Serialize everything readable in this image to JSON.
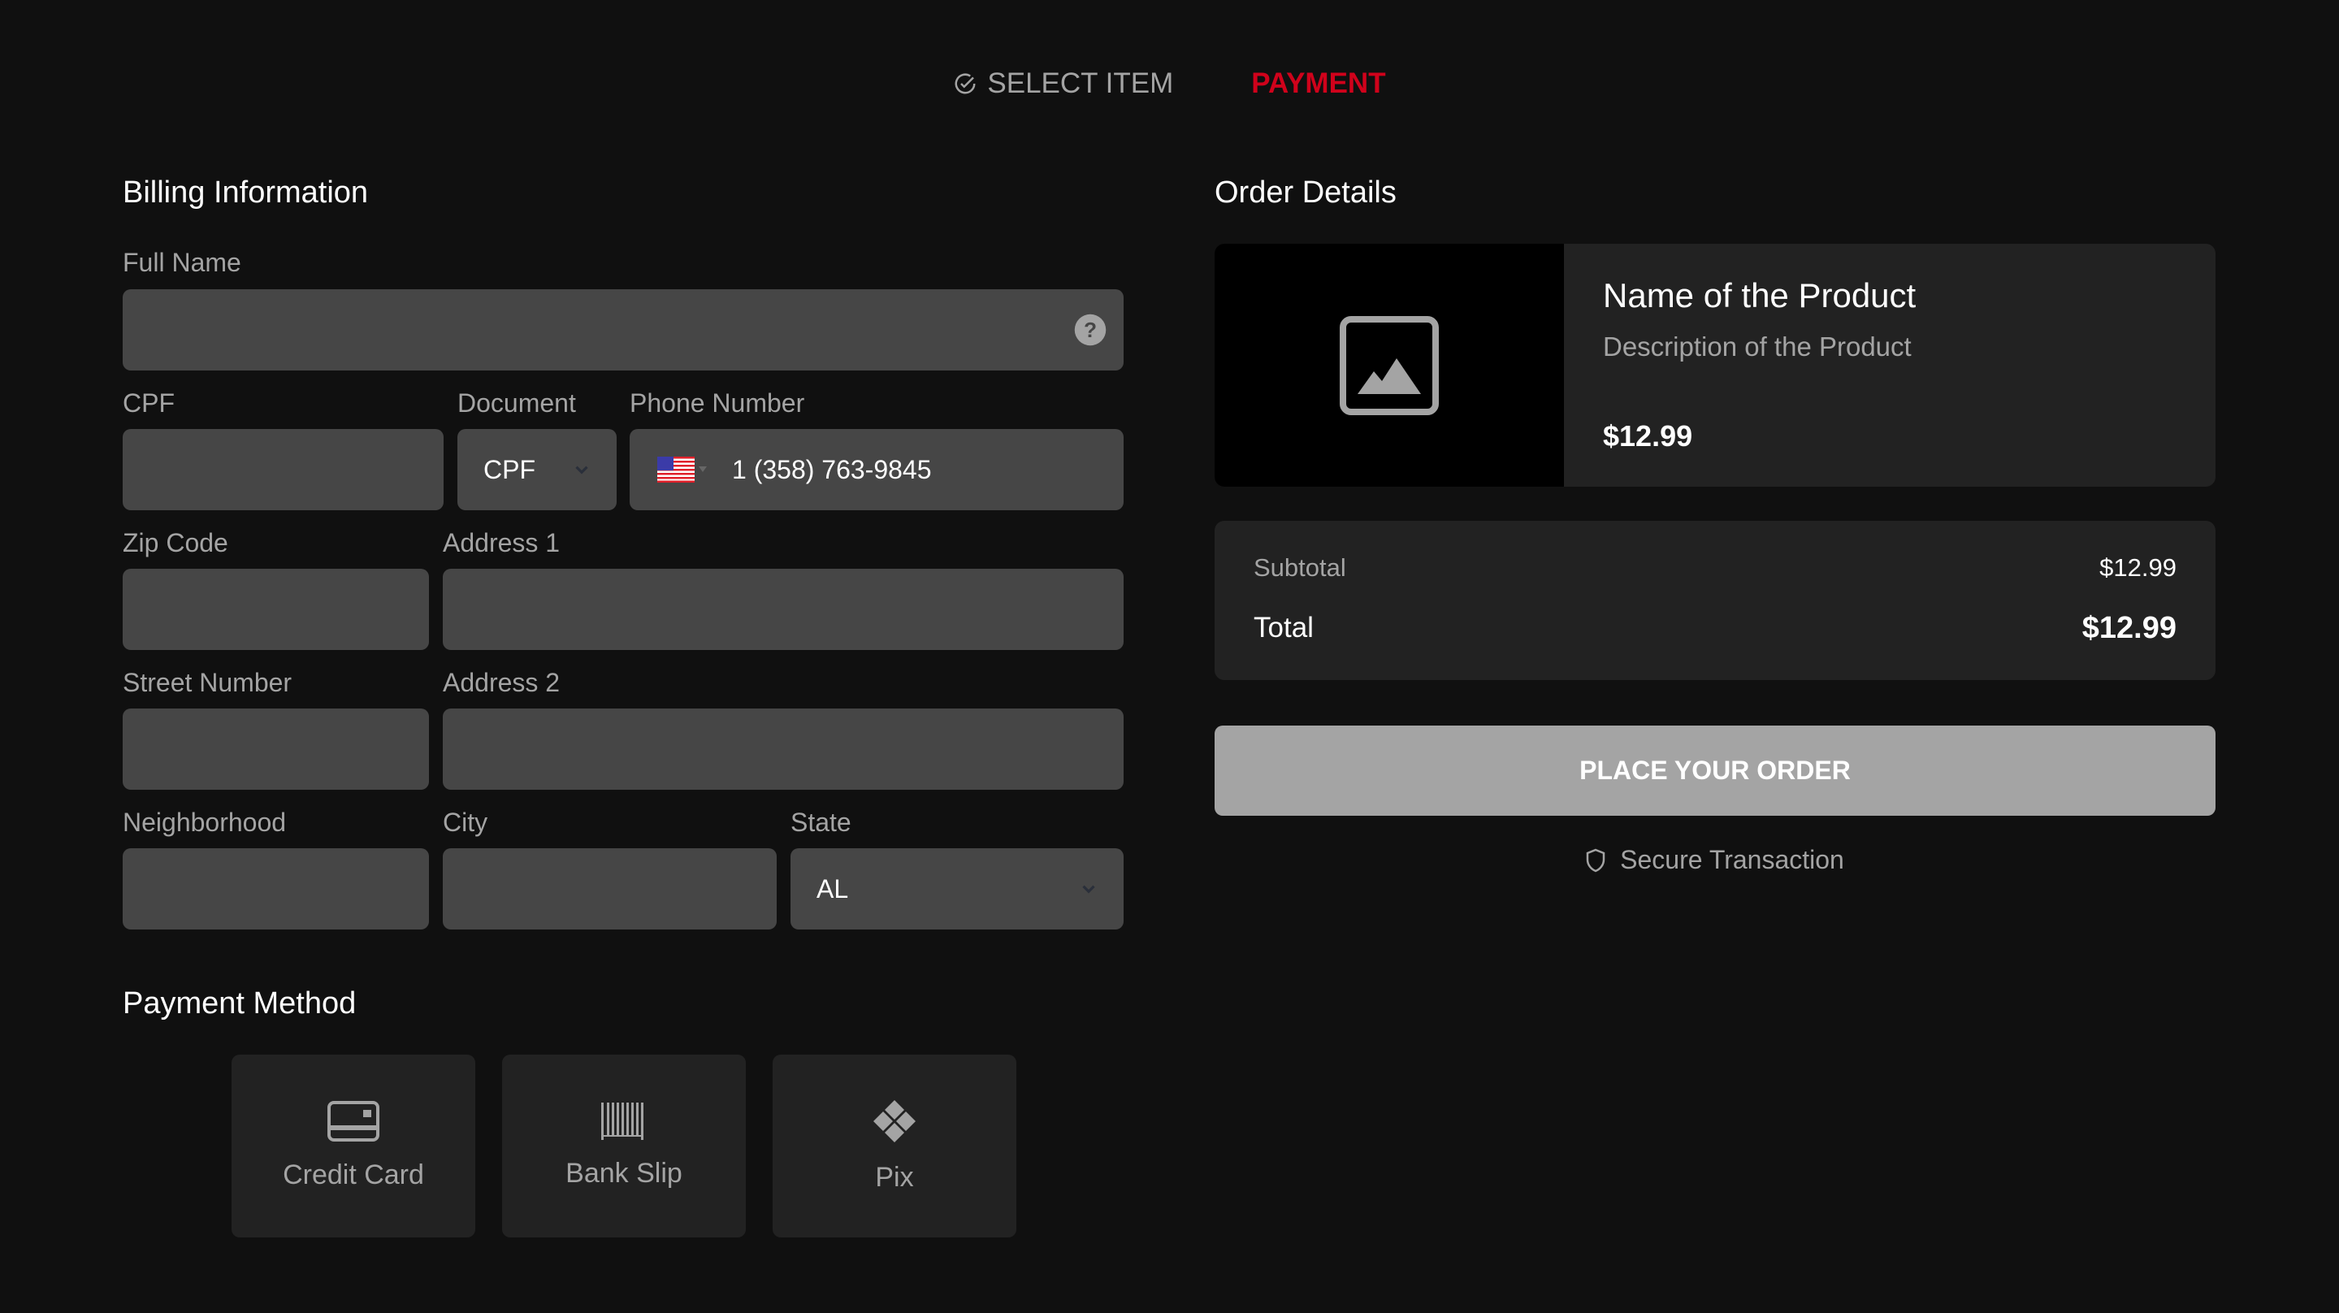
{
  "stepper": {
    "steps": [
      {
        "label": "SELECT ITEM",
        "state": "done",
        "icon": "check-circle-icon"
      },
      {
        "label": "PAYMENT",
        "state": "active"
      }
    ],
    "active_color": "#d0021b"
  },
  "billing": {
    "title": "Billing Information",
    "full_name": {
      "label": "Full Name",
      "value": "",
      "help_icon": "question-circle-icon"
    },
    "cpf": {
      "label": "CPF",
      "value": ""
    },
    "document": {
      "label": "Document",
      "selected": "CPF"
    },
    "phone": {
      "label": "Phone Number",
      "country_flag": "us-flag-icon",
      "value": "1 (358) 763-9845"
    },
    "zip": {
      "label": "Zip Code",
      "value": ""
    },
    "address1": {
      "label": "Address 1",
      "value": ""
    },
    "street_number": {
      "label": "Street Number",
      "value": ""
    },
    "address2": {
      "label": "Address 2",
      "value": ""
    },
    "neighborhood": {
      "label": "Neighborhood",
      "value": ""
    },
    "city": {
      "label": "City",
      "value": ""
    },
    "state": {
      "label": "State",
      "selected": "AL"
    }
  },
  "payment_method": {
    "title": "Payment Method",
    "options": [
      {
        "label": "Credit Card",
        "icon": "credit-card-icon"
      },
      {
        "label": "Bank Slip",
        "icon": "barcode-icon"
      },
      {
        "label": "Pix",
        "icon": "pix-icon"
      }
    ]
  },
  "order": {
    "title": "Order Details",
    "product": {
      "name": "Name of the Product",
      "description": "Description of the Product",
      "price": "$12.99",
      "image_icon": "image-placeholder-icon"
    },
    "subtotal_label": "Subtotal",
    "subtotal_value": "$12.99",
    "total_label": "Total",
    "total_value": "$12.99",
    "place_order_label": "PLACE YOUR ORDER",
    "secure_label": "Secure Transaction"
  }
}
